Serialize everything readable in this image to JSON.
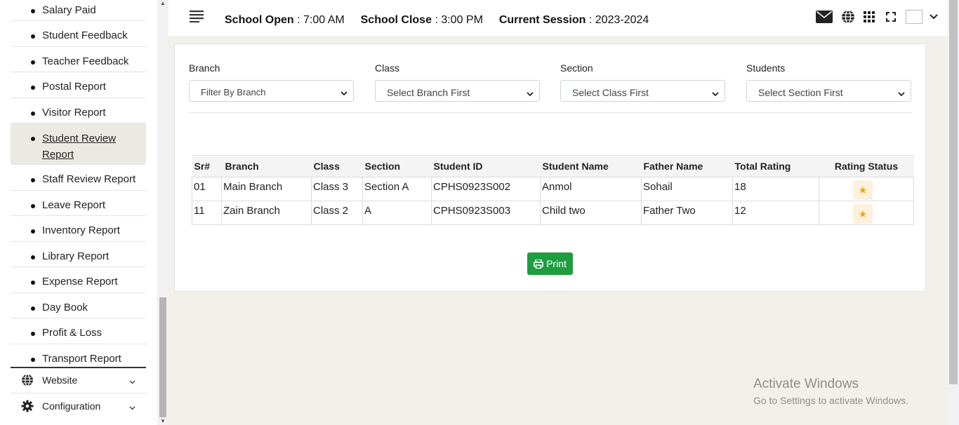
{
  "sidebar": {
    "items": [
      {
        "label": "Salary Paid"
      },
      {
        "label": "Student Feedback"
      },
      {
        "label": "Teacher Feedback"
      },
      {
        "label": "Postal Report"
      },
      {
        "label": "Visitor Report"
      },
      {
        "label": "Student Review Report",
        "active": true
      },
      {
        "label": "Staff Review Report"
      },
      {
        "label": "Leave Report"
      },
      {
        "label": "Inventory Report"
      },
      {
        "label": "Library Report"
      },
      {
        "label": "Expense Report"
      },
      {
        "label": "Day Book"
      },
      {
        "label": "Profit & Loss"
      },
      {
        "label": "Transport Report"
      }
    ],
    "sections": {
      "website": {
        "label": "Website",
        "icon": "globe-icon"
      },
      "configuration": {
        "label": "Configuration",
        "icon": "gear-icon"
      }
    }
  },
  "header": {
    "school_open_label": "School Open",
    "school_open_value": ": 7:00 AM",
    "school_close_label": "School Close",
    "school_close_value": ": 3:00 PM",
    "session_label": "Current Session",
    "session_value": ": 2023-2024",
    "icons": [
      "mail-icon",
      "globe-icon",
      "apps-grid-icon",
      "fullscreen-icon",
      "user-avatar",
      "chevron-down-icon"
    ]
  },
  "filters": {
    "branch": {
      "label": "Branch",
      "selected": "Filter By Branch"
    },
    "class": {
      "label": "Class",
      "selected": "Select Branch First"
    },
    "section": {
      "label": "Section",
      "selected": "Select Class First"
    },
    "students": {
      "label": "Students",
      "selected": "Select Section First"
    }
  },
  "table": {
    "headers": [
      "Sr#",
      "Branch",
      "Class",
      "Section",
      "Student ID",
      "Student Name",
      "Father Name",
      "Total Rating",
      "Rating Status"
    ],
    "rows": [
      {
        "sr": "01",
        "branch": "Main Branch",
        "class": "Class 3",
        "section": "Section A",
        "student_id": "CPHS0923S002",
        "student_name": "Anmol",
        "father_name": "Sohail",
        "total_rating": "18",
        "rating_status": "★"
      },
      {
        "sr": "11",
        "branch": "Zain Branch",
        "class": "Class 2",
        "section": "A",
        "student_id": "CPHS0923S003",
        "student_name": "Child two",
        "father_name": "Father Two",
        "total_rating": "12",
        "rating_status": "★"
      }
    ]
  },
  "print_button": {
    "label": "Print"
  },
  "watermark": {
    "line1": "Activate Windows",
    "line2": "Go to Settings to activate Windows."
  },
  "colors": {
    "accent_green": "#1e9e3e",
    "star": "#f0a500",
    "page_bg": "#f1f0ea"
  }
}
